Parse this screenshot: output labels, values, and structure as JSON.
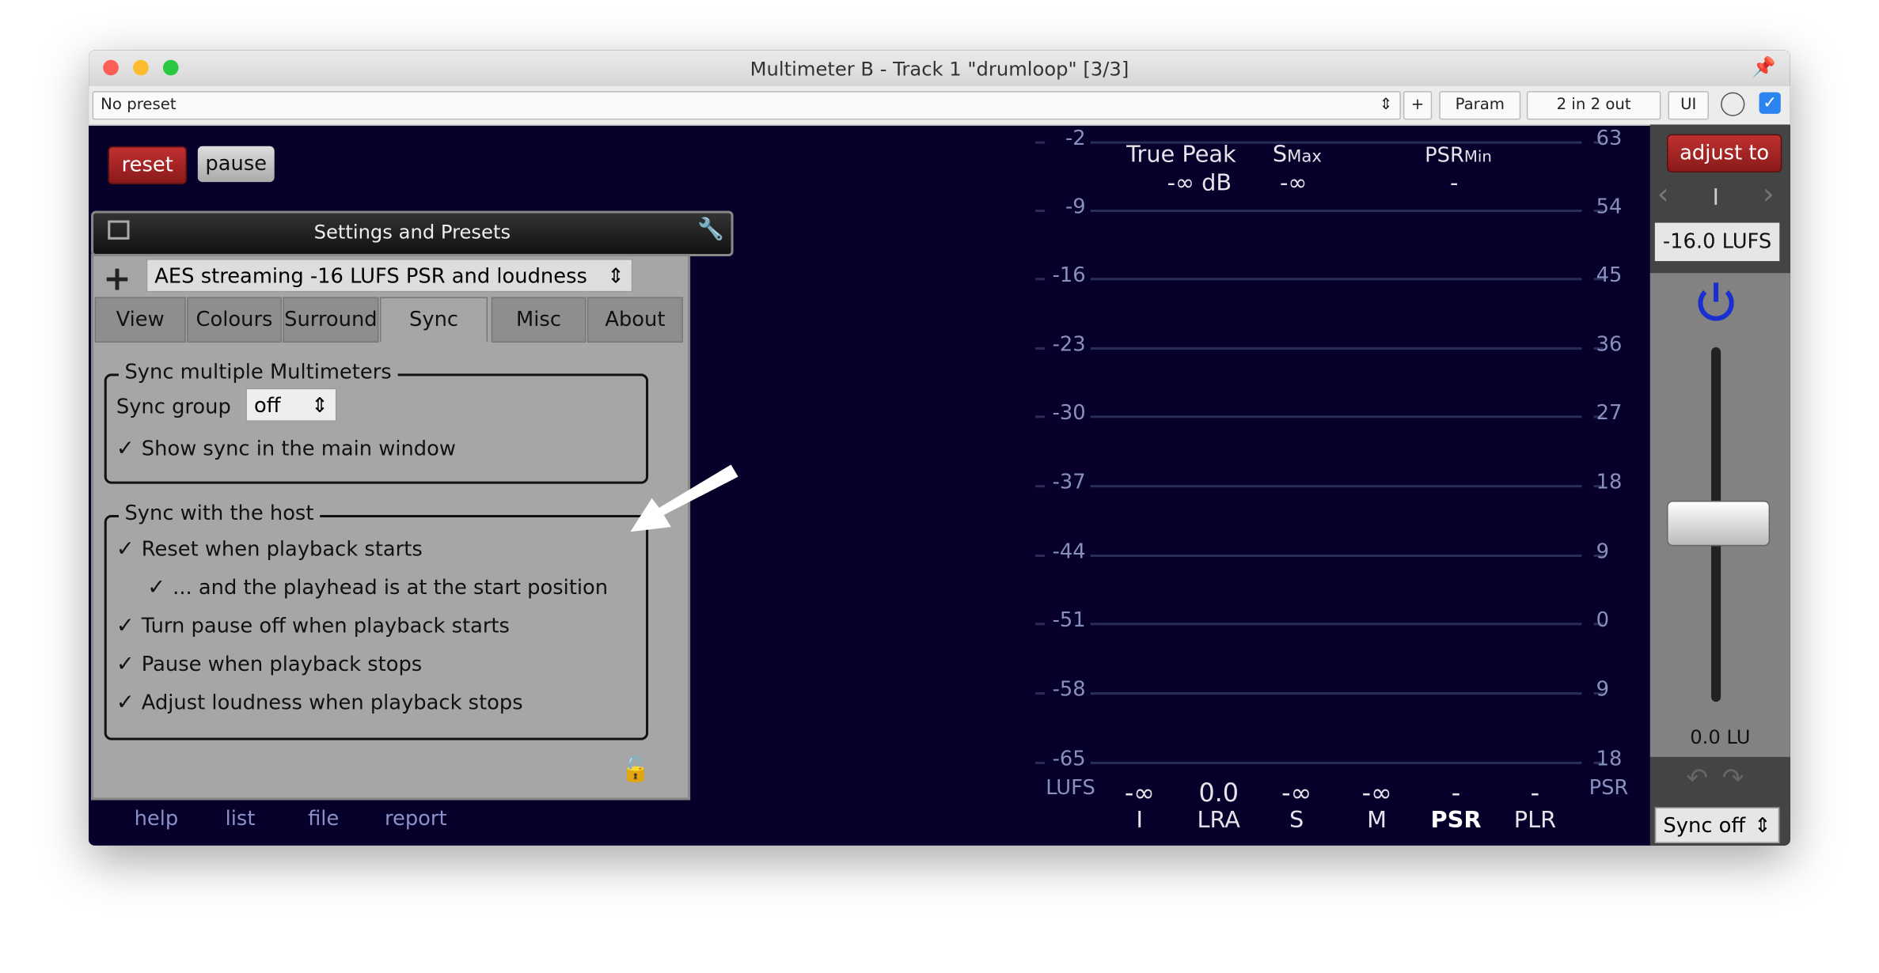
{
  "window": {
    "title": "Multimeter B - Track 1 \"drumloop\" [3/3]"
  },
  "toolbar": {
    "preset": "No preset",
    "plus": "+",
    "param": "Param",
    "io": "2 in 2 out",
    "ui": "UI"
  },
  "controls": {
    "reset": "reset",
    "pause": "pause"
  },
  "settings": {
    "header": "Settings and Presets",
    "plus": "+",
    "preset": "AES streaming -16 LUFS PSR and loudness",
    "tabs": [
      "View",
      "Colours",
      "Surround",
      "Sync",
      "Misc",
      "About"
    ],
    "active_tab": "Sync",
    "group1": {
      "title": "Sync multiple Multimeters",
      "sync_group_label": "Sync group",
      "sync_group_value": "off",
      "show_sync": "Show sync in the main window"
    },
    "group2": {
      "title": "Sync with the host",
      "items": [
        "Reset when playback starts",
        "... and the playhead is at the start position",
        "Turn pause off when playback starts",
        "Pause when playback stops",
        "Adjust loudness when playback stops"
      ]
    },
    "check": "✓"
  },
  "meter": {
    "left_scale": [
      "-2",
      "-9",
      "-16",
      "-23",
      "-30",
      "-37",
      "-44",
      "-51",
      "-58",
      "-65"
    ],
    "right_scale": [
      "63",
      "54",
      "45",
      "36",
      "27",
      "18",
      "9",
      "0",
      "9",
      "18"
    ],
    "left_unit": "LUFS",
    "right_unit": "PSR",
    "true_peak": {
      "label": "True Peak",
      "value": "-∞ dB"
    },
    "smax": {
      "label": "S",
      "sub": "Max",
      "value": "-∞"
    },
    "psrmin": {
      "label": "PSR",
      "sub": "Min",
      "value": "-"
    },
    "readouts": [
      {
        "v": "-∞",
        "l": "I"
      },
      {
        "v": "0.0",
        "l": "LRA"
      },
      {
        "v": "-∞",
        "l": "S"
      },
      {
        "v": "-∞",
        "l": "M"
      },
      {
        "v": "-",
        "l": "PSR"
      },
      {
        "v": "-",
        "l": "PLR"
      }
    ]
  },
  "right_panel": {
    "adjust": "adjust to",
    "mode": "I",
    "target": "-16.0 LUFS",
    "gain": "0.0 LU",
    "sync": "Sync off",
    "power_color": "#1a2fd0"
  },
  "footer": {
    "links": [
      "help",
      "list",
      "file",
      "report"
    ]
  }
}
